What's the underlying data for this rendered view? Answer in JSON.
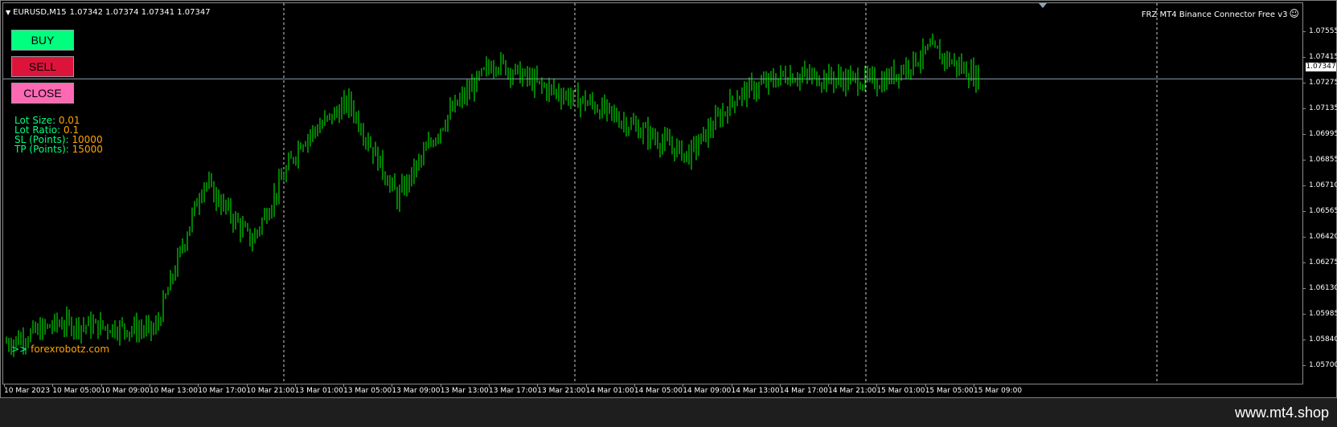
{
  "header": {
    "symbol": "EURUSD,M15",
    "ohlc": "1.07342 1.07374 1.07341 1.07347",
    "ea_title": "FRZ MT4 Binance Connector Free v3",
    "ea_icon": "smiley-icon"
  },
  "panel": {
    "buy_label": "BUY",
    "sell_label": "SELL",
    "close_label": "CLOSE",
    "lot_size_label": "Lot Size:",
    "lot_size_value": "0.01",
    "lot_ratio_label": "Lot Ratio:",
    "lot_ratio_value": "0.1",
    "sl_label": "SL (Points):",
    "sl_value": "10000",
    "tp_label": "TP (Points):",
    "tp_value": "15000",
    "promo_arrow": ">>",
    "promo_site": "forexrobotz.com"
  },
  "colors": {
    "candle": "#00ff00",
    "buy": "#00ff7f",
    "sell": "#dc143c",
    "close": "#ff69b4",
    "value": "#ffa500",
    "background": "#000000"
  },
  "price_axis": {
    "labels": [
      "1.07555",
      "1.07415",
      "1.07275",
      "1.07135",
      "1.06995",
      "1.06855",
      "1.06710",
      "1.06565",
      "1.06420",
      "1.06275",
      "1.06130",
      "1.05985",
      "1.05840",
      "1.05700"
    ],
    "current_price": "1.07347"
  },
  "time_axis": {
    "labels": [
      "10 Mar 2023",
      "10 Mar 05:00",
      "10 Mar 09:00",
      "10 Mar 13:00",
      "10 Mar 17:00",
      "10 Mar 21:00",
      "13 Mar 01:00",
      "13 Mar 05:00",
      "13 Mar 09:00",
      "13 Mar 13:00",
      "13 Mar 17:00",
      "13 Mar 21:00",
      "14 Mar 01:00",
      "14 Mar 05:00",
      "14 Mar 09:00",
      "14 Mar 13:00",
      "14 Mar 17:00",
      "14 Mar 21:00",
      "15 Mar 01:00",
      "15 Mar 05:00",
      "15 Mar 09:00"
    ]
  },
  "chart_data": {
    "type": "line",
    "title": "",
    "xlabel": "",
    "ylabel": "",
    "ylim": [
      1.057,
      1.0762
    ],
    "series": [
      {
        "name": "",
        "x": [
          "10 Mar 2023",
          "10 Mar 05:00",
          "10 Mar 09:00",
          "10 Mar 13:00",
          "10 Mar 17:00",
          "10 Mar 21:00",
          "13 Mar 01:00",
          "13 Mar 05:00",
          "13 Mar 09:00",
          "13 Mar 13:00",
          "13 Mar 17:00",
          "13 Mar 21:00",
          "14 Mar 01:00",
          "14 Mar 05:00",
          "14 Mar 09:00",
          "14 Mar 13:00",
          "14 Mar 17:00",
          "14 Mar 21:00",
          "15 Mar 01:00",
          "15 Mar 05:00",
          "15 Mar 09:00"
        ],
        "values": [
          1.0581,
          1.0592,
          1.059,
          1.0588,
          1.0675,
          1.064,
          1.0698,
          1.0721,
          1.0665,
          1.0712,
          1.0745,
          1.073,
          1.072,
          1.0705,
          1.069,
          1.0725,
          1.0737,
          1.0735,
          1.0733,
          1.0752,
          1.0735
        ]
      }
    ],
    "grid": true,
    "session_separators": [
      "13 Mar 01:00",
      "14 Mar 01:00",
      "15 Mar 01:00",
      "16 Mar 01:00"
    ]
  },
  "footer": {
    "site": "www.mt4.shop"
  }
}
